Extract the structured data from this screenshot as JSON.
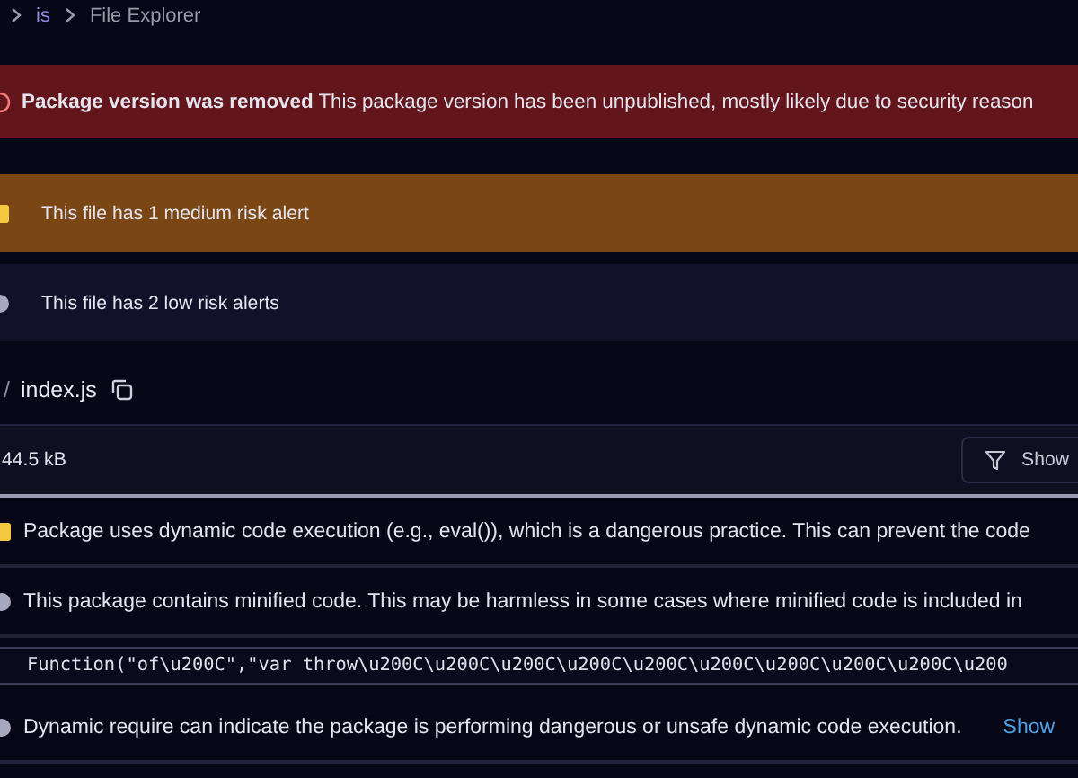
{
  "breadcrumb": [
    "is",
    "File Explorer"
  ],
  "banner": {
    "kind": "error",
    "title": "Package version was removed",
    "message": "This package version has been unpublished, mostly likely due to security reason"
  },
  "file_alerts": [
    {
      "kind": "medium",
      "text": "This file has 1 medium risk alert"
    },
    {
      "kind": "low",
      "text": "This file has 2 low risk alerts"
    }
  ],
  "file": {
    "separator": "/",
    "name": "index.js"
  },
  "toolbar": {
    "size": "44.5 kB",
    "filter_button": "Show"
  },
  "alerts": [
    {
      "kind": "medium",
      "text": "Package uses dynamic code execution (e.g., eval()), which is a dangerous practice. This can prevent the code"
    },
    {
      "kind": "low",
      "text": "This package contains minified code. This may be harmless in some cases where minified code is included in",
      "code": "Function(\"of\\u200C\",\"var throw\\u200C\\u200C\\u200C\\u200C\\u200C\\u200C\\u200C\\u200C\\u200C\\u200"
    },
    {
      "kind": "low",
      "text": "Dynamic require can indicate the package is performing dangerous or unsafe dynamic code execution.",
      "link": "Show"
    }
  ]
}
